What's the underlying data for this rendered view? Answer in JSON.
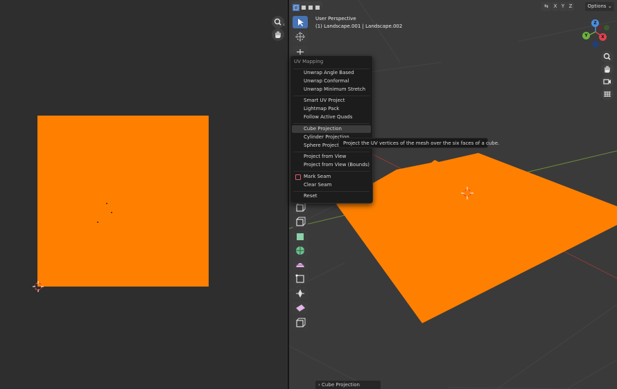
{
  "viewport": {
    "title": "User Perspective",
    "object_info": "(1) Landscape.001 | Landscape.002",
    "options_label": "Options",
    "axis_x": "X",
    "axis_y": "Y",
    "axis_z": "Z",
    "gizmo_z": "Z",
    "gizmo_y": "Y",
    "gizmo_x": "X"
  },
  "uv_menu": {
    "title": "UV Mapping",
    "items": [
      "Unwrap Angle Based",
      "Unwrap Conformal",
      "Unwrap Minimum Stretch",
      "Smart UV Project",
      "Lightmap Pack",
      "Follow Active Quads",
      "Cube Projection",
      "Cylinder Projection",
      "Sphere Projection",
      "Project from View",
      "Project from View (Bounds)",
      "Mark Seam",
      "Clear Seam",
      "Reset"
    ],
    "highlighted": "Cube Projection"
  },
  "tooltip": "Project the UV vertices of the mesh over the six faces of a cube.",
  "last_operator": "Cube Projection",
  "colors": {
    "mesh": "#ff8000",
    "menu_bg": "#1c1c1c",
    "accent": "#4772b3",
    "gizmo_x": "#e0424f",
    "gizmo_y": "#6cb33e",
    "gizmo_z": "#4a8fe0"
  },
  "icons": [
    "zoom-icon",
    "hand-icon",
    "select-box-icon",
    "cursor-icon",
    "move-icon",
    "camera-icon",
    "grid-icon",
    "chevron-down-icon"
  ]
}
